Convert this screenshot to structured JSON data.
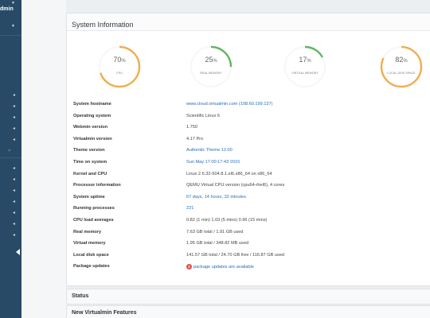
{
  "sidebar": {
    "account_text": "dmin",
    "items_count_note": ""
  },
  "panel": {
    "title": "System Information"
  },
  "gauges": [
    {
      "label": "CPU",
      "value": 70,
      "color": "#f0ad4e"
    },
    {
      "label": "Real memory",
      "value": 25,
      "color": "#5cb85c"
    },
    {
      "label": "Virtual memory",
      "value": 17,
      "color": "#5cb85c"
    },
    {
      "label": "Local disk space",
      "value": 82,
      "color": "#f0ad4e"
    }
  ],
  "info": [
    {
      "key": "System hostname",
      "value": "www.cloud.virtualmin.com (108.60.199.137)",
      "link": true
    },
    {
      "key": "Operating system",
      "value": "Scientific Linux 6",
      "link": false
    },
    {
      "key": "Webmin version",
      "value": "1.750",
      "link": false
    },
    {
      "key": "Virtualmin version",
      "value": "4.17 Pro",
      "link": false
    },
    {
      "key": "Theme version",
      "value": "Authentic Theme 12.00",
      "link": true
    },
    {
      "key": "Time on system",
      "value": "Sun May 17 00:17:43 2015",
      "link": true
    },
    {
      "key": "Kernel and CPU",
      "value": "Linux 2.6.32-504.8.1.el6.x86_64 on x86_64",
      "link": false
    },
    {
      "key": "Processor information",
      "value": "QEMU Virtual CPU version (cpu64-rhel6), 4 cores",
      "link": false
    },
    {
      "key": "System uptime",
      "value": "67 days, 14 hours, 32 minutes",
      "link": true
    },
    {
      "key": "Running processes",
      "value": "221",
      "link": true
    },
    {
      "key": "CPU load averages",
      "value": "0.82 (1 min) 1.03 (5 mins) 0.96 (15 mins)",
      "link": false
    },
    {
      "key": "Real memory",
      "value": "7.63 GB total / 1.91 GB used",
      "link": false
    },
    {
      "key": "Virtual memory",
      "value": "1.95 GB total / 348.82 MB used",
      "link": false
    },
    {
      "key": "Local disk space",
      "value": "141.57 GB total / 24.70 GB free / 116.87 GB used",
      "link": false
    },
    {
      "key": "Package updates",
      "value": "package updates are available",
      "link": true,
      "badge": "2"
    }
  ],
  "panels": {
    "status": "Status",
    "features": "New Virtualmin Features"
  }
}
